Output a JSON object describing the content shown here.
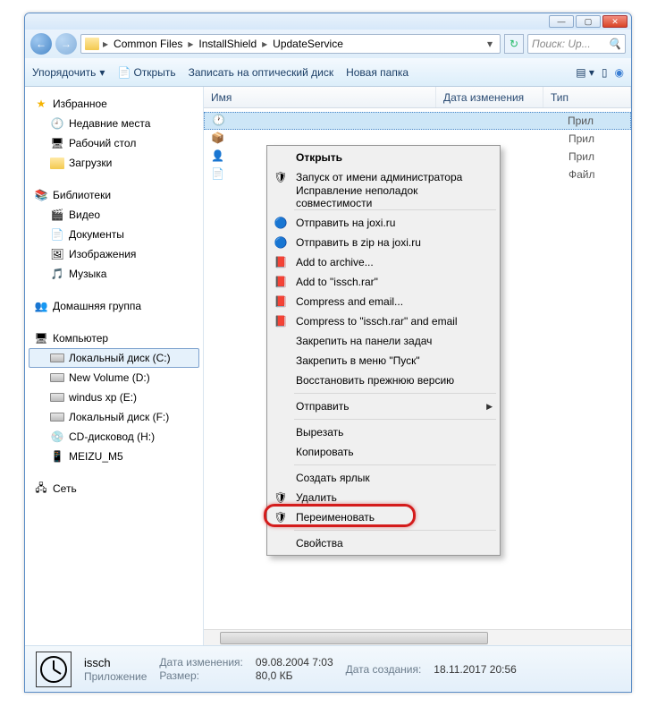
{
  "breadcrumbs": [
    "Common Files",
    "InstallShield",
    "UpdateService"
  ],
  "search_placeholder": "Поиск: Up...",
  "toolbar": {
    "organize": "Упорядочить",
    "open": "Открыть",
    "burn": "Записать на оптический диск",
    "newfolder": "Новая папка"
  },
  "columns": {
    "name": "Имя",
    "date": "Дата изменения",
    "type": "Тип"
  },
  "nav": {
    "favorites": {
      "title": "Избранное",
      "items": [
        "Недавние места",
        "Рабочий стол",
        "Загрузки"
      ]
    },
    "libraries": {
      "title": "Библиотеки",
      "items": [
        "Видео",
        "Документы",
        "Изображения",
        "Музыка"
      ]
    },
    "homegroup": {
      "title": "Домашняя группа"
    },
    "computer": {
      "title": "Компьютер",
      "items": [
        "Локальный диск (C:)",
        "New Volume (D:)",
        "windus xp (E:)",
        "Локальный диск (F:)",
        "CD-дисковод (H:)",
        "MEIZU_M5"
      ]
    },
    "network": {
      "title": "Сеть"
    }
  },
  "file_types": [
    "Прил",
    "Прил",
    "Прил",
    "Файл"
  ],
  "context_menu": [
    {
      "label": "Открыть",
      "bold": true
    },
    {
      "label": "Запуск от имени администратора",
      "icon": "shield"
    },
    {
      "label": "Исправление неполадок совместимости"
    },
    {
      "sep": true
    },
    {
      "label": "Отправить на joxi.ru",
      "icon": "joxi"
    },
    {
      "label": "Отправить в zip на joxi.ru",
      "icon": "joxi"
    },
    {
      "label": "Add to archive...",
      "icon": "rar"
    },
    {
      "label": "Add to \"issch.rar\"",
      "icon": "rar"
    },
    {
      "label": "Compress and email...",
      "icon": "rar"
    },
    {
      "label": "Compress to \"issch.rar\" and email",
      "icon": "rar"
    },
    {
      "label": "Закрепить на панели задач"
    },
    {
      "label": "Закрепить в меню \"Пуск\""
    },
    {
      "label": "Восстановить прежнюю версию"
    },
    {
      "sep": true
    },
    {
      "label": "Отправить",
      "submenu": true
    },
    {
      "sep": true
    },
    {
      "label": "Вырезать"
    },
    {
      "label": "Копировать"
    },
    {
      "sep": true
    },
    {
      "label": "Создать ярлык"
    },
    {
      "label": "Удалить",
      "icon": "shield"
    },
    {
      "label": "Переименовать",
      "icon": "shield",
      "highlight": true
    },
    {
      "sep": true
    },
    {
      "label": "Свойства"
    }
  ],
  "details": {
    "name": "issch",
    "type": "Приложение",
    "date_mod_label": "Дата изменения:",
    "date_mod": "09.08.2004 7:03",
    "size_label": "Размер:",
    "size": "80,0 КБ",
    "date_created_label": "Дата создания:",
    "date_created": "18.11.2017 20:56"
  }
}
